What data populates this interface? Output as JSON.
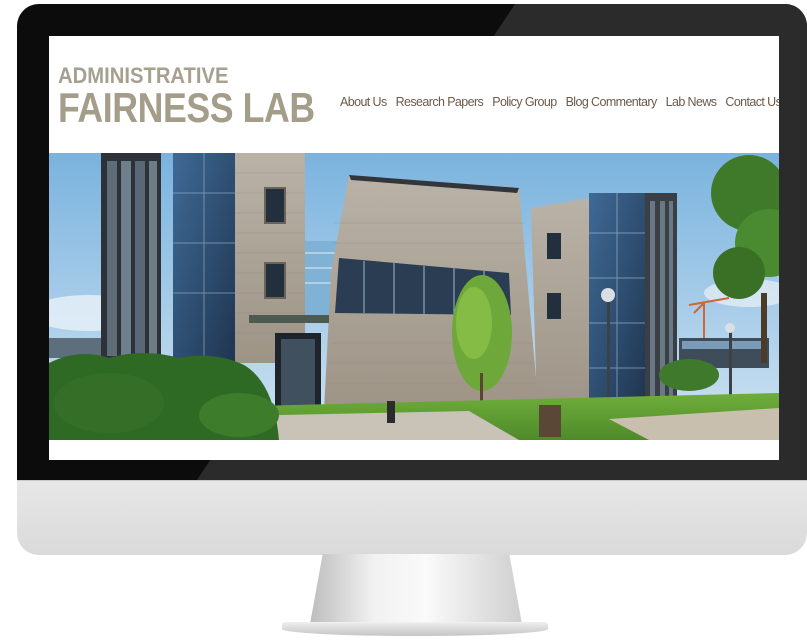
{
  "site": {
    "logo_line1": "ADMINISTRATIVE",
    "logo_line2": "FAIRNESS LAB"
  },
  "nav": {
    "items": [
      {
        "label": "About Us"
      },
      {
        "label": "Research Papers"
      },
      {
        "label": "Policy Group"
      },
      {
        "label": "Blog Commentary"
      },
      {
        "label": "Lab News"
      },
      {
        "label": "Contact Us"
      }
    ]
  },
  "colors": {
    "logo": "#a49d89",
    "nav_text": "#6b5a4b",
    "bezel": "#0c0c0c",
    "chin": "#e0e0e0"
  },
  "hero": {
    "image": "modern-building-photo"
  }
}
